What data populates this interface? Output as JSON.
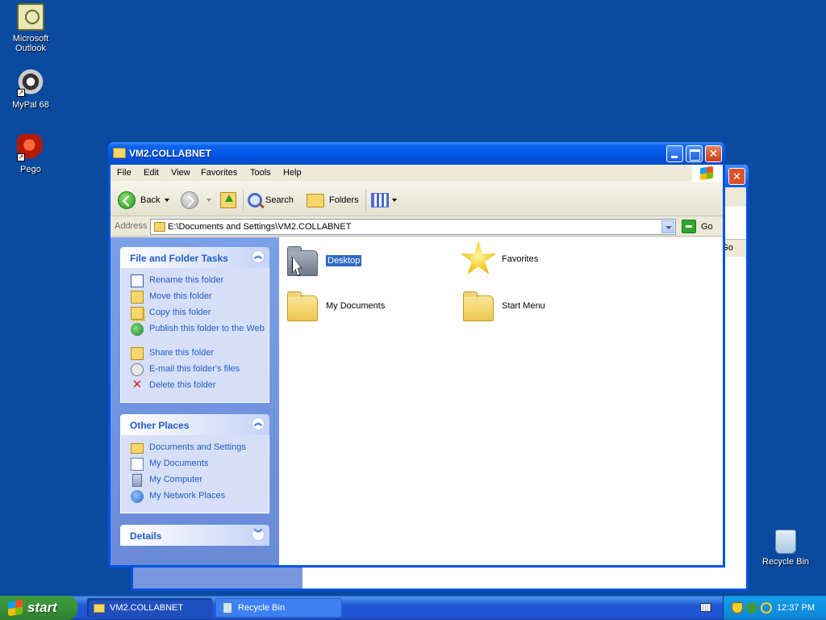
{
  "desktop": {
    "icons": [
      {
        "label": "Microsoft\nOutlook",
        "line1": "Microsoft",
        "line2": "Outlook"
      },
      {
        "label": "MyPal 68"
      },
      {
        "label": "Pego"
      },
      {
        "label": "Recycle Bin"
      }
    ]
  },
  "window": {
    "title": "VM2.COLLABNET",
    "menu": [
      "File",
      "Edit",
      "View",
      "Favorites",
      "Tools",
      "Help"
    ],
    "toolbar": {
      "back": "Back",
      "search": "Search",
      "folders": "Folders"
    },
    "address": {
      "label": "Address",
      "value": "E:\\Documents and Settings\\VM2.COLLABNET",
      "go": "Go"
    },
    "file_tasks": {
      "title": "File and Folder Tasks",
      "items": [
        "Rename this folder",
        "Move this folder",
        "Copy this folder",
        "Publish this folder to the Web",
        "Share this folder",
        "E-mail this folder's files",
        "Delete this folder"
      ]
    },
    "other_places": {
      "title": "Other Places",
      "items": [
        "Documents and Settings",
        "My Documents",
        "My Computer",
        "My Network Places"
      ]
    },
    "details": {
      "title": "Details"
    },
    "items": [
      {
        "label": "Desktop",
        "selected": true
      },
      {
        "label": "Favorites"
      },
      {
        "label": "My Documents"
      },
      {
        "label": "Start Menu"
      }
    ]
  },
  "background_window": {
    "address_go_fragment": "Go"
  },
  "taskbar": {
    "start": "start",
    "tasks": [
      "VM2.COLLABNET",
      "Recycle Bin"
    ],
    "clock": "12:37 PM"
  },
  "colors": {
    "desktop": "#0a4a9f",
    "titlebar": "#0055e5",
    "selection": "#316ac5",
    "task_link": "#215dc6"
  }
}
